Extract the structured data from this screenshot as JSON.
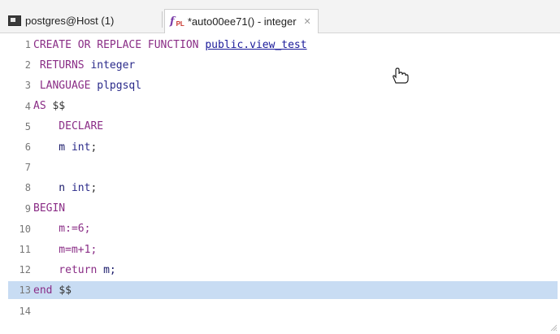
{
  "tabs": [
    {
      "label": "postgres@Host (1)",
      "icon": "database-sql-icon",
      "active": false
    },
    {
      "label": "*auto00ee71() - integer",
      "icon": "plpgsql-function-icon",
      "badge": "PL",
      "active": true,
      "close_glyph": "✕"
    }
  ],
  "editor": {
    "lines": [
      {
        "num": "1",
        "tokens": [
          {
            "t": "CREATE OR REPLACE FUNCTION ",
            "c": "kw"
          },
          {
            "t": "public.view_test",
            "c": "link"
          }
        ]
      },
      {
        "num": "2",
        "tokens": [
          {
            "t": " RETURNS ",
            "c": "kw"
          },
          {
            "t": "integer",
            "c": "ty"
          }
        ]
      },
      {
        "num": "3",
        "tokens": [
          {
            "t": " LANGUAGE ",
            "c": "kw"
          },
          {
            "t": "plpgsql",
            "c": "ty"
          }
        ]
      },
      {
        "num": "4",
        "tokens": [
          {
            "t": "AS ",
            "c": "kw"
          },
          {
            "t": "$$",
            "c": "pl"
          }
        ]
      },
      {
        "num": "5",
        "tokens": [
          {
            "t": "    DECLARE",
            "c": "kw"
          }
        ]
      },
      {
        "num": "6",
        "tokens": [
          {
            "t": "    m ",
            "c": "nm"
          },
          {
            "t": "int",
            "c": "ty"
          },
          {
            "t": ";",
            "c": "pl"
          }
        ]
      },
      {
        "num": "7",
        "tokens": []
      },
      {
        "num": "8",
        "tokens": [
          {
            "t": "    n ",
            "c": "nm"
          },
          {
            "t": "int",
            "c": "ty"
          },
          {
            "t": ";",
            "c": "pl"
          }
        ]
      },
      {
        "num": "9",
        "tokens": [
          {
            "t": "BEGIN",
            "c": "kw"
          }
        ]
      },
      {
        "num": "10",
        "tokens": [
          {
            "t": "    m:=6;",
            "c": "kw"
          }
        ]
      },
      {
        "num": "11",
        "tokens": [
          {
            "t": "    m=m+1;",
            "c": "kw"
          }
        ]
      },
      {
        "num": "12",
        "tokens": [
          {
            "t": "    return ",
            "c": "kw"
          },
          {
            "t": "m;",
            "c": "nm"
          }
        ]
      },
      {
        "num": "13",
        "tokens": [
          {
            "t": "end ",
            "c": "kw"
          },
          {
            "t": "$$",
            "c": "pl"
          }
        ],
        "highlighted": true
      },
      {
        "num": "14",
        "tokens": []
      }
    ]
  },
  "colors": {
    "keyword": "#8a2d86",
    "type": "#2a2a8a",
    "link": "#1a1a9a",
    "current_line": "#c8dcf3"
  },
  "cursor": "hand-pointer-icon"
}
